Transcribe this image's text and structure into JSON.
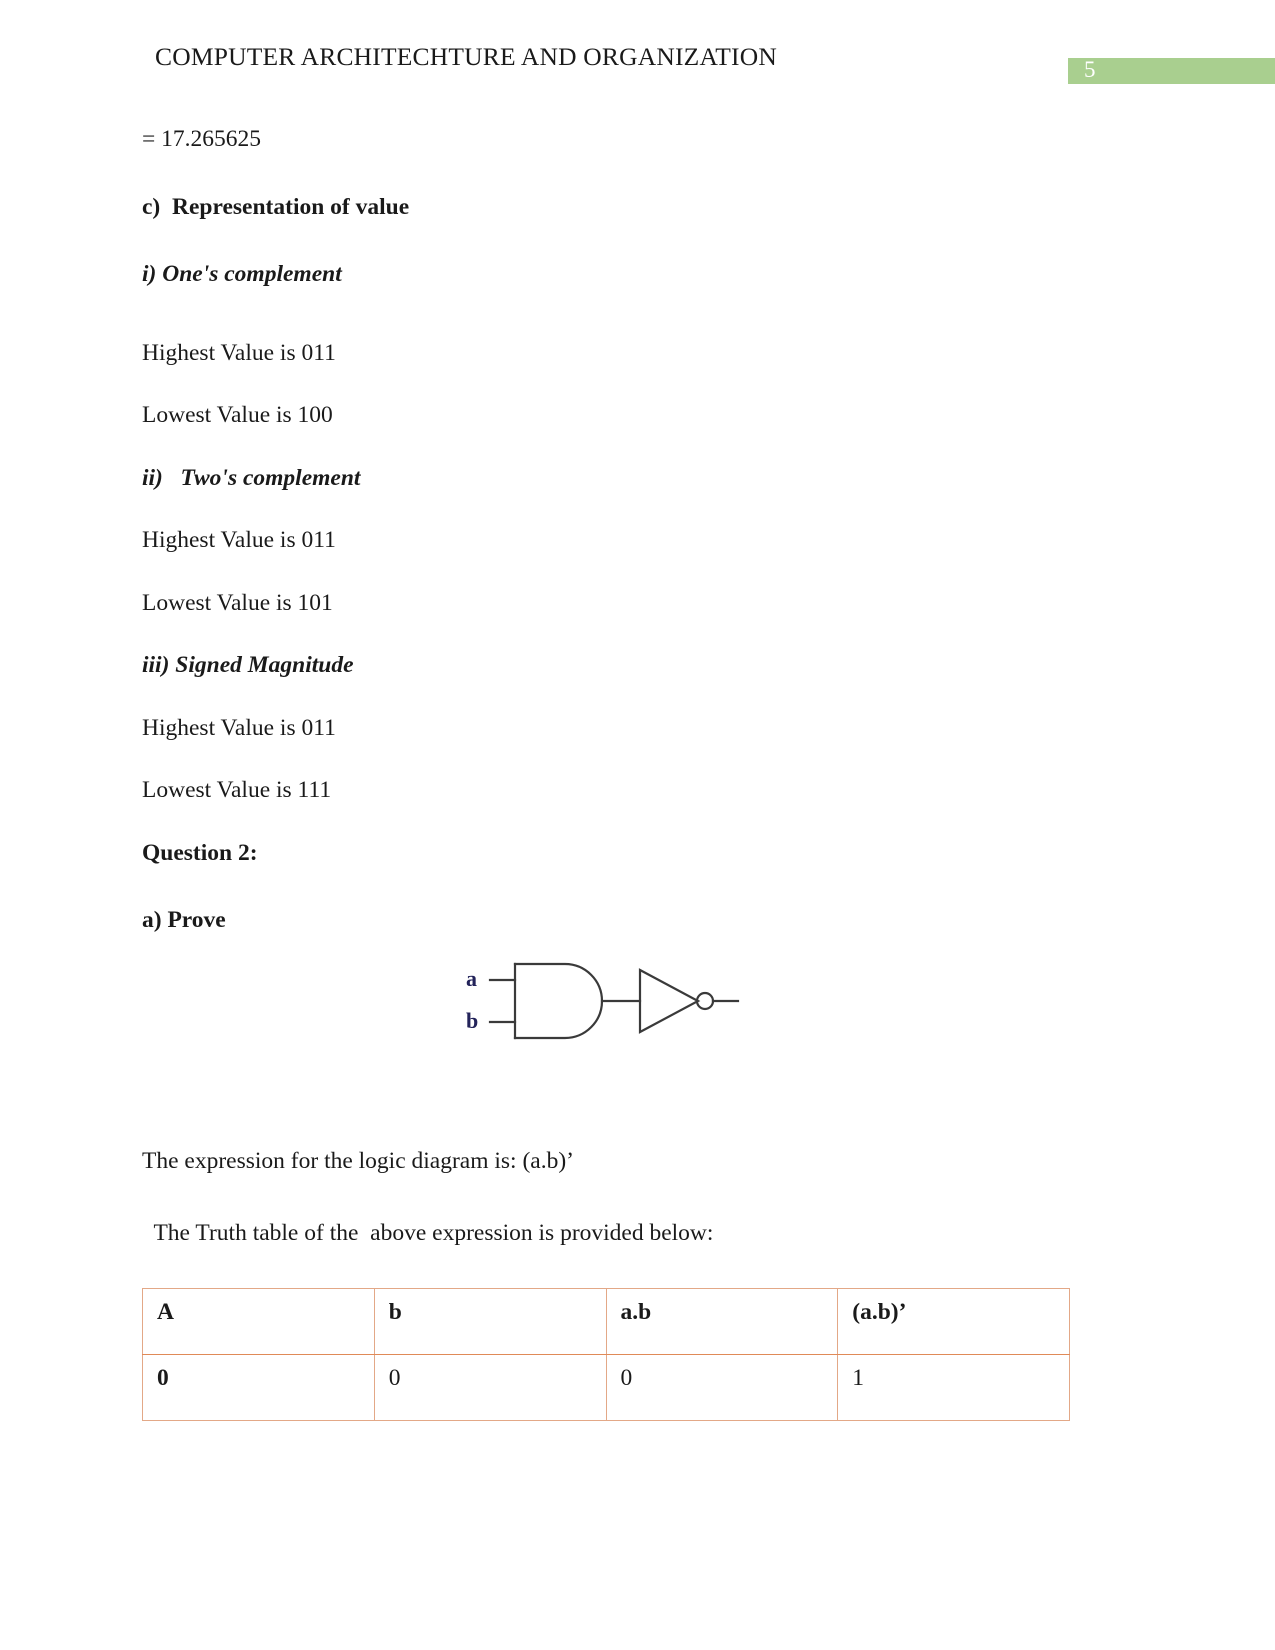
{
  "header": {
    "title": "COMPUTER ARCHITECHTURE AND ORGANIZATION",
    "page_number": "5",
    "badge_color": "#a9cf8f"
  },
  "body": {
    "result_line": "= 17.265625",
    "section_c": "c)  Representation of value",
    "subsections": [
      {
        "heading": "i) One's complement",
        "highest": "Highest Value is 011",
        "lowest": "Lowest Value is 100"
      },
      {
        "heading": "ii)   Two's complement",
        "highest": "Highest Value is 011",
        "lowest": "Lowest Value is 101"
      },
      {
        "heading": "iii) Signed Magnitude",
        "highest": "Highest Value is 011",
        "lowest": "Lowest Value is 111"
      }
    ],
    "question_heading": "Question 2:",
    "part_a": "a) Prove",
    "expression_line": "The expression for the logic diagram is: (a.b)’",
    "truth_table_intro": " The Truth table of the  above expression is provided below:"
  },
  "diagram": {
    "input_a_label": "a",
    "input_b_label": "b",
    "label_color": "#23235a",
    "stroke_color": "#3a3a3a"
  },
  "truth_table": {
    "border_color": "#e3a887",
    "headers": [
      "A",
      "b",
      "a.b",
      "(a.b)’"
    ],
    "rows": [
      [
        "0",
        "0",
        "0",
        "1"
      ]
    ]
  }
}
